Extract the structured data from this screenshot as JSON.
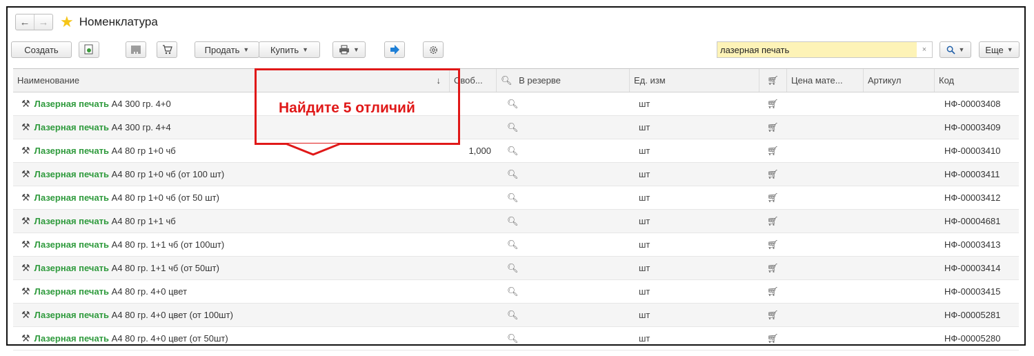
{
  "window": {
    "title": "Номенклатура"
  },
  "toolbar": {
    "create_label": "Создать",
    "sell_label": "Продать",
    "buy_label": "Купить",
    "more_label": "Еще"
  },
  "search": {
    "value": "лазерная печать",
    "clear": "×"
  },
  "columns": {
    "name": "Наименование",
    "sort_arrow": "↓",
    "free": "Своб...",
    "reserve": "В резерве",
    "unit": "Ед. изм",
    "price": "Цена мате...",
    "article": "Артикул",
    "code": "Код"
  },
  "rows": [
    {
      "highlight": "Лазерная печать",
      "rest": " А4 300 гр. 4+0",
      "qty": "",
      "unit": "шт",
      "code": "НФ-00003408"
    },
    {
      "highlight": "Лазерная печать",
      "rest": " А4 300 гр. 4+4",
      "qty": "",
      "unit": "шт",
      "code": "НФ-00003409"
    },
    {
      "highlight": "Лазерная печать",
      "rest": " А4 80 гр 1+0 чб",
      "qty": "1,000",
      "unit": "шт",
      "code": "НФ-00003410"
    },
    {
      "highlight": "Лазерная печать",
      "rest": " А4 80 гр 1+0 чб (от 100 шт)",
      "qty": "",
      "unit": "шт",
      "code": "НФ-00003411"
    },
    {
      "highlight": "Лазерная печать",
      "rest": " А4 80 гр 1+0 чб (от 50 шт)",
      "qty": "",
      "unit": "шт",
      "code": "НФ-00003412"
    },
    {
      "highlight": "Лазерная печать",
      "rest": " А4 80 гр 1+1 чб",
      "qty": "",
      "unit": "шт",
      "code": "НФ-00004681"
    },
    {
      "highlight": "Лазерная печать",
      "rest": " А4 80 гр. 1+1 чб (от 100шт)",
      "qty": "",
      "unit": "шт",
      "code": "НФ-00003413"
    },
    {
      "highlight": "Лазерная печать",
      "rest": " А4 80 гр. 1+1 чб (от 50шт)",
      "qty": "",
      "unit": "шт",
      "code": "НФ-00003414"
    },
    {
      "highlight": "Лазерная печать",
      "rest": " А4 80 гр. 4+0 цвет",
      "qty": "",
      "unit": "шт",
      "code": "НФ-00003415"
    },
    {
      "highlight": "Лазерная печать",
      "rest": " А4 80 гр. 4+0 цвет (от 100шт)",
      "qty": "",
      "unit": "шт",
      "code": "НФ-00005281"
    },
    {
      "highlight": "Лазерная печать",
      "rest": " А4 80 гр. 4+0 цвет (от 50шт)",
      "qty": "",
      "unit": "шт",
      "code": "НФ-00005280"
    }
  ],
  "overlay": {
    "text": "Найдите 5 отличий"
  },
  "colors": {
    "highlight": "#2e9a3c",
    "callout": "#e01818",
    "search_bg": "#fdf3b7",
    "star": "#f5c518"
  }
}
